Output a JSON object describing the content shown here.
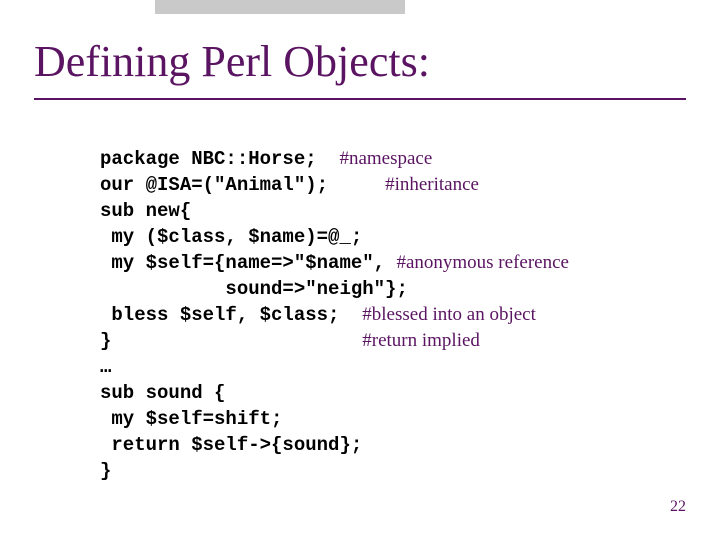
{
  "title": "Defining Perl Objects:",
  "page_number": "22",
  "code": {
    "l1_kw": "package NBC::Horse;",
    "l1_pad": "  ",
    "l1_cmt": "#namespace",
    "l2_kw": "our @ISA=(\"Animal\");",
    "l2_pad": "     ",
    "l2_cmt": "#inheritance",
    "l3_kw": "sub new{",
    "l4_kw": " my ($class, $name)=@_;",
    "l5_kw": " my $self={name=>\"$name\", ",
    "l5_cmt": "#anonymous reference",
    "l6_kw": "           sound=>\"neigh\"};",
    "l7_kw": " bless $self, $class;",
    "l7_pad": "  ",
    "l7_cmt": "#blessed into an object",
    "l8_kw": "}",
    "l8_pad": "                      ",
    "l8_cmt": "#return implied",
    "l9_kw": "…",
    "l10_kw": "sub sound {",
    "l11_kw": " my $self=shift;",
    "l12_kw": " return $self->{sound};",
    "l13_kw": "}"
  }
}
